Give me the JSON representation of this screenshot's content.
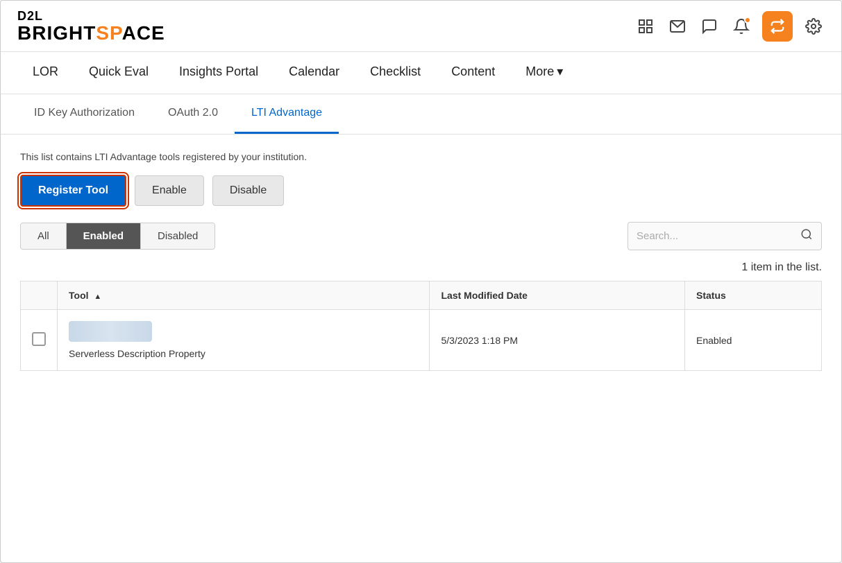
{
  "header": {
    "logo_d2l": "D2L",
    "logo_bright_prefix": "BRIGHT",
    "logo_bright_suffix": "SP",
    "logo_bright_rest": "CE"
  },
  "icons": {
    "grid": "⊞",
    "mail": "✉",
    "chat": "💬",
    "bell": "🔔",
    "transfer": "⇄",
    "gear": "⚙"
  },
  "navbar": {
    "items": [
      {
        "label": "LOR"
      },
      {
        "label": "Quick Eval"
      },
      {
        "label": "Insights Portal"
      },
      {
        "label": "Calendar"
      },
      {
        "label": "Checklist"
      },
      {
        "label": "Content"
      },
      {
        "label": "More"
      }
    ]
  },
  "subtabs": {
    "items": [
      {
        "label": "ID Key Authorization",
        "active": false
      },
      {
        "label": "OAuth 2.0",
        "active": false
      },
      {
        "label": "LTI Advantage",
        "active": true
      }
    ]
  },
  "main": {
    "description": "This list contains LTI Advantage tools registered by your institution.",
    "buttons": {
      "register": "Register Tool",
      "enable": "Enable",
      "disable": "Disable"
    },
    "filter_tabs": {
      "all": "All",
      "enabled": "Enabled",
      "disabled": "Disabled"
    },
    "search_placeholder": "Search...",
    "item_count": "1 item in the list.",
    "table": {
      "headers": {
        "checkbox": "",
        "tool": "Tool",
        "last_modified": "Last Modified Date",
        "status": "Status"
      },
      "rows": [
        {
          "tool_name": "Serverless Description Property",
          "last_modified": "5/3/2023 1:18 PM",
          "status": "Enabled"
        }
      ]
    }
  }
}
